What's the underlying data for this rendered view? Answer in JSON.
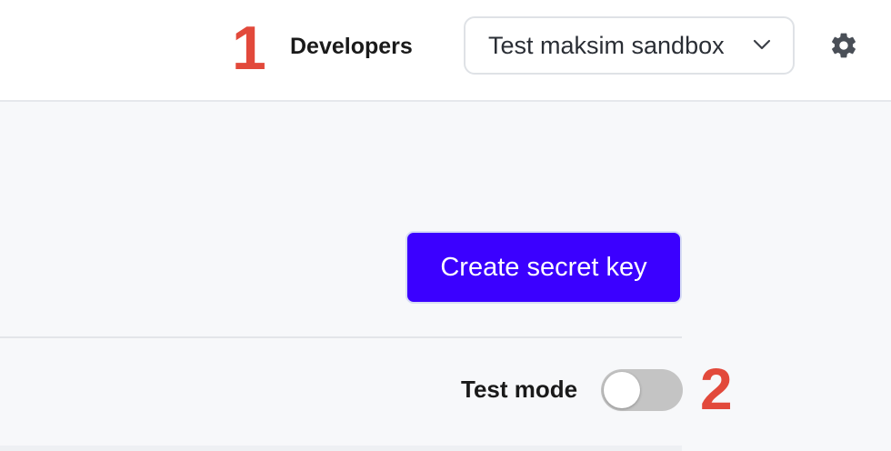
{
  "annotations": {
    "marker_1": "1",
    "marker_2": "2"
  },
  "header": {
    "developers_link": "Developers",
    "account_selector": {
      "selected": "Test maksim sandbox"
    },
    "settings_icon": "gear-icon"
  },
  "main": {
    "create_button_label": "Create secret key",
    "test_mode": {
      "label": "Test mode",
      "enabled": false
    }
  },
  "colors": {
    "primary_button": "#3b00ff",
    "annotation_red": "#e2493b",
    "toggle_off": "#c4c4c4"
  }
}
